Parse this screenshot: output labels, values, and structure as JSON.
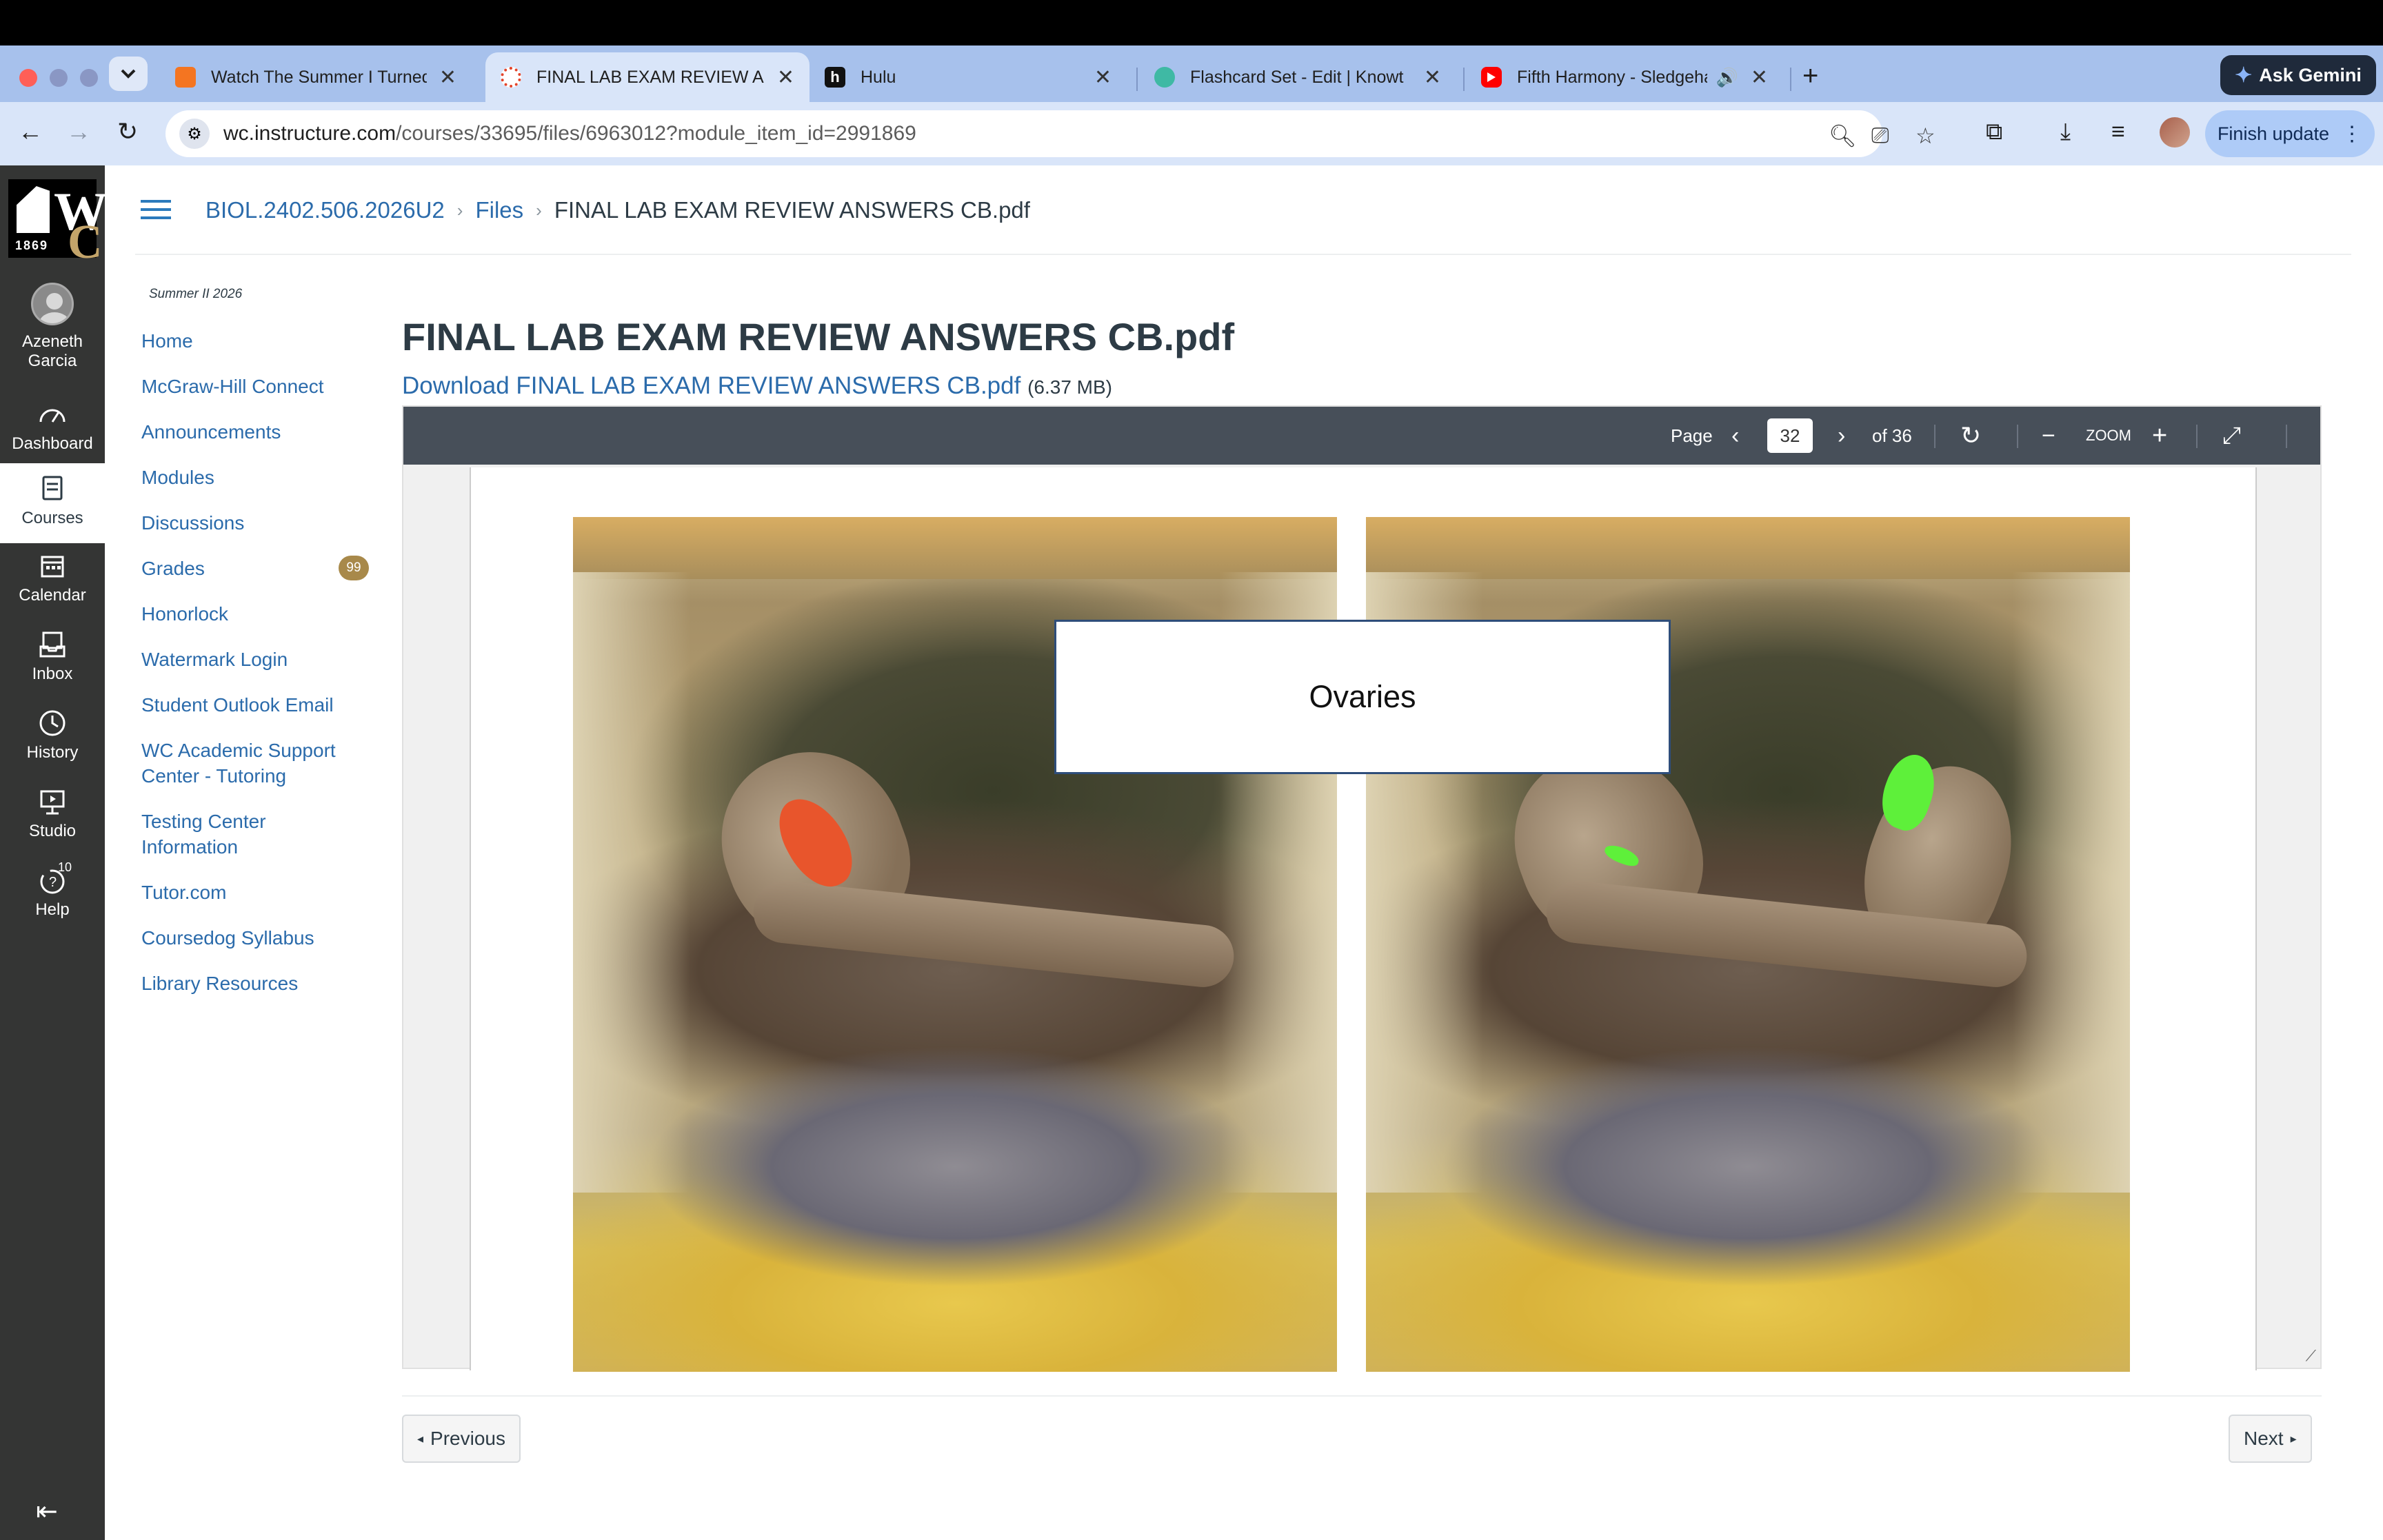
{
  "browser": {
    "tabs": [
      {
        "title": "Watch The Summer I Turned I",
        "icon": "crunchyroll-icon",
        "color": "#f47521"
      },
      {
        "title": "FINAL LAB EXAM REVIEW AN",
        "icon": "canvas-icon",
        "color": "#e4452b"
      },
      {
        "title": "Hulu",
        "icon": "hulu-icon",
        "color": "#111111"
      },
      {
        "title": "Flashcard Set - Edit | Knowt",
        "icon": "knowt-icon",
        "color": "#3fb9a4"
      },
      {
        "title": "Fifth Harmony - Sledgeha",
        "icon": "youtube-icon",
        "color": "#ff0000"
      }
    ],
    "ask_gemini": "Ask Gemini",
    "url_host": "wc.instructure.com",
    "url_path": "/courses/33695/files/6963012?module_item_id=2991869",
    "finish_update": "Finish update"
  },
  "global_nav": {
    "logo_year": "1869",
    "user_name": "Azeneth Garcia",
    "items": [
      {
        "label": "Dashboard",
        "icon": "dashboard-icon"
      },
      {
        "label": "Courses",
        "icon": "courses-icon"
      },
      {
        "label": "Calendar",
        "icon": "calendar-icon"
      },
      {
        "label": "Inbox",
        "icon": "inbox-icon"
      },
      {
        "label": "History",
        "icon": "history-icon"
      },
      {
        "label": "Studio",
        "icon": "studio-icon"
      },
      {
        "label": "Help",
        "icon": "help-icon",
        "badge": "10"
      }
    ]
  },
  "breadcrumb": {
    "course": "BIOL.2402.506.2026U2",
    "files": "Files",
    "current": "FINAL LAB EXAM REVIEW ANSWERS CB.pdf"
  },
  "course_nav": {
    "term": "Summer II 2026",
    "items": [
      {
        "label": "Home"
      },
      {
        "label": "McGraw-Hill Connect"
      },
      {
        "label": "Announcements"
      },
      {
        "label": "Modules"
      },
      {
        "label": "Discussions"
      },
      {
        "label": "Grades",
        "badge": "99"
      },
      {
        "label": "Honorlock"
      },
      {
        "label": "Watermark Login"
      },
      {
        "label": "Student Outlook Email"
      },
      {
        "label": "WC Academic Support Center - Tutoring"
      },
      {
        "label": "Testing Center Information"
      },
      {
        "label": "Tutor.com"
      },
      {
        "label": "Coursedog Syllabus"
      },
      {
        "label": "Library Resources"
      }
    ]
  },
  "file": {
    "title": "FINAL LAB EXAM REVIEW ANSWERS CB.pdf",
    "download_label": "Download FINAL LAB EXAM REVIEW ANSWERS CB.pdf",
    "size": "(6.37 MB)"
  },
  "viewer": {
    "page_label": "Page",
    "page_current": "32",
    "page_total": "of 36",
    "zoom_label": "ZOOM",
    "slide_label": "Ovaries"
  },
  "footer": {
    "previous": "Previous",
    "next": "Next"
  }
}
